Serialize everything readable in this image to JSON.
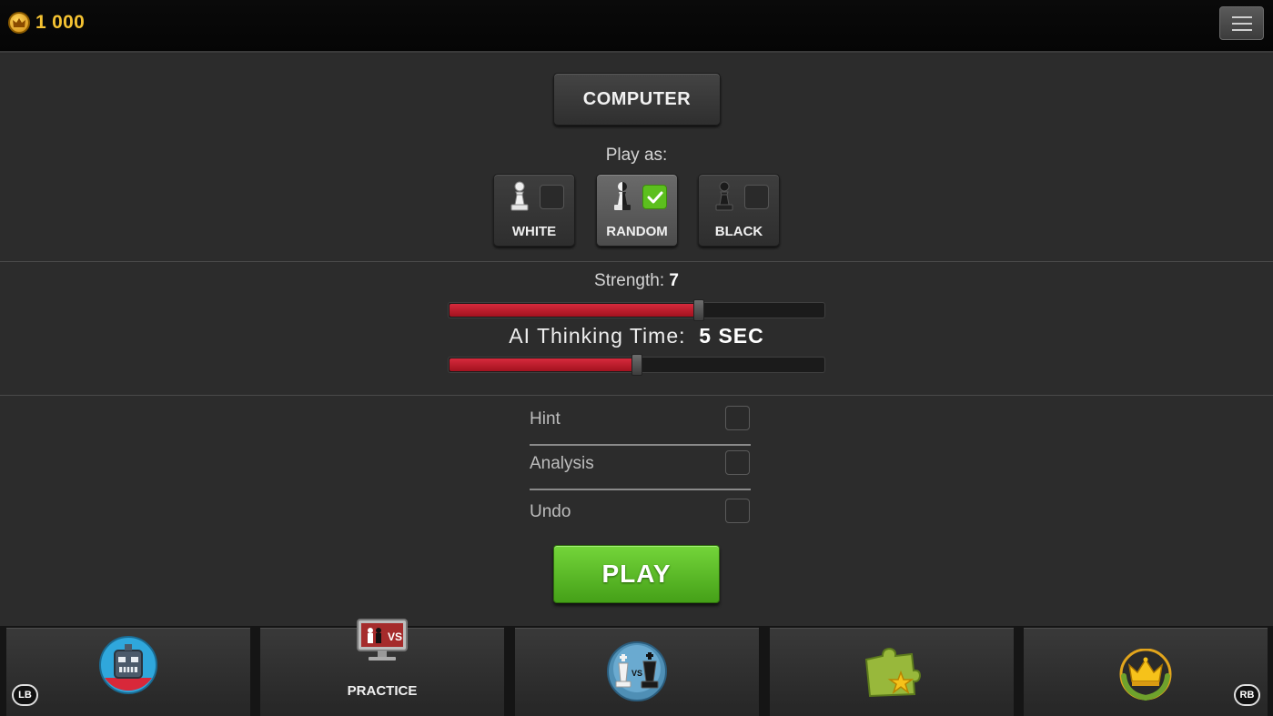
{
  "topbar": {
    "coins": "1 000",
    "coin_icon": "crown-coin-icon",
    "menu_icon": "hamburger-menu-icon"
  },
  "mode": {
    "label": "COMPUTER"
  },
  "play_as": {
    "label": "Play as:",
    "options": [
      {
        "label": "WHITE",
        "checked": false
      },
      {
        "label": "RANDOM",
        "checked": true
      },
      {
        "label": "BLACK",
        "checked": false
      }
    ]
  },
  "strength": {
    "label": "Strength:",
    "value": "7",
    "fill_fraction": 0.665
  },
  "thinking_time": {
    "label": "AI Thinking Time:",
    "value": "5 SEC",
    "fill_fraction": 0.5
  },
  "options": [
    {
      "label": "Hint",
      "checked": false
    },
    {
      "label": "Analysis",
      "checked": false
    },
    {
      "label": "Undo",
      "checked": false
    }
  ],
  "play_button": {
    "label": "PLAY"
  },
  "bottom_nav": {
    "lb": "LB",
    "rb": "RB",
    "tabs": [
      {
        "icon": "robot-icon",
        "label": ""
      },
      {
        "icon": "practice-computer-icon",
        "label": "PRACTICE"
      },
      {
        "icon": "versus-pieces-icon",
        "label": ""
      },
      {
        "icon": "puzzle-star-icon",
        "label": ""
      },
      {
        "icon": "crown-laurel-icon",
        "label": ""
      }
    ]
  },
  "colors": {
    "accent_red": "#c41e2e",
    "play_green": "#5cbf1e",
    "coin_gold": "#f4c232"
  }
}
